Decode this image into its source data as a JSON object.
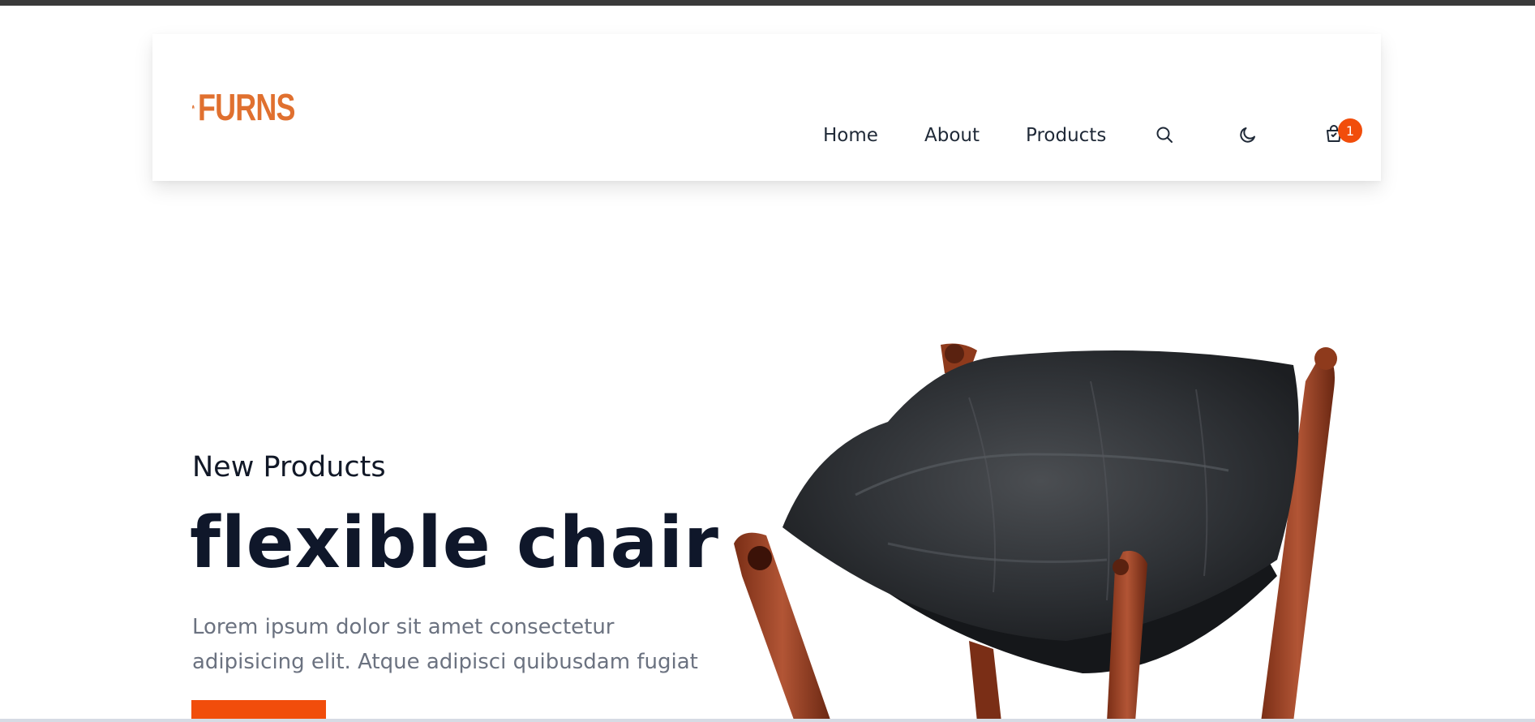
{
  "brand": {
    "name": "FURNS",
    "color": "#e0702f"
  },
  "nav": {
    "links": [
      "Home",
      "About",
      "Products"
    ],
    "icons": [
      "search-icon",
      "moon-icon",
      "cart-icon"
    ],
    "cart_count": "1",
    "badge_color": "#f14d0b"
  },
  "hero": {
    "subtitle": "New Products",
    "title": "flexible chair",
    "description": "Lorem ipsum dolor sit amet consectetur adipisicing elit. Atque adipisci quibusdam fugiat",
    "button_color": "#f14d0b",
    "image": "leather-chair"
  }
}
